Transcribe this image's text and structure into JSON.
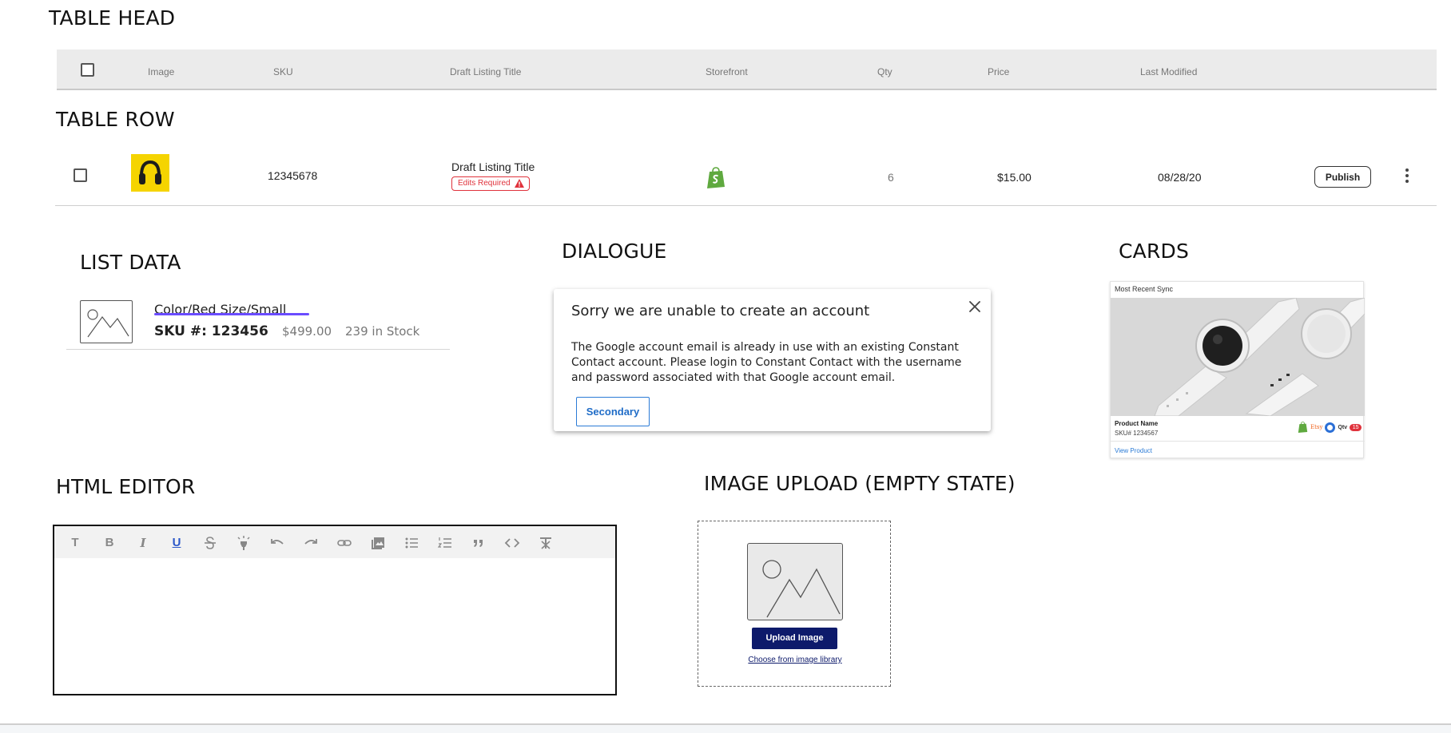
{
  "sections": {
    "table_head": "TABLE HEAD",
    "table_row": "TABLE ROW",
    "list_data": "LIST DATA",
    "dialogue": "DIALOGUE",
    "cards": "CARDS",
    "html_editor": "HTML EDITOR",
    "image_upload": "IMAGE UPLOAD (EMPTY STATE)"
  },
  "table": {
    "columns": [
      "Image",
      "SKU",
      "Draft Listing Title",
      "Storefront",
      "Qty",
      "Price",
      "Last Modified"
    ],
    "row": {
      "checked": false,
      "image_icon": "headphones-thumbnail",
      "sku": "12345678",
      "title": "Draft Listing Title",
      "badge": "Edits Required",
      "badge_icon": "warning-icon",
      "storefront_icon": "shopify-icon",
      "qty": "6",
      "price": "$15.00",
      "last_modified": "08/28/20",
      "publish_label": "Publish",
      "more_icon": "more-vertical-icon"
    }
  },
  "list_data": {
    "variant": "Color/Red   Size/Small",
    "sku": "SKU #: 123456",
    "price": "$499.00",
    "stock": "239 in Stock"
  },
  "dialog": {
    "title": "Sorry we are unable to create an account",
    "body": "The Google account email is already in use with an existing Constant Contact account.  Please login to Constant Contact with the username and password associated with that Google account email.",
    "button_label": "Secondary",
    "close_icon": "close-icon"
  },
  "card": {
    "header": "Most Recent Sync",
    "product_name": "Product Name",
    "sku": "SKU# 1234567",
    "link": "View Product",
    "channel_etsy": "Etsy",
    "channel_qtv": "Qtv",
    "count": "15"
  },
  "editor": {
    "toolbar": [
      "text-icon",
      "bold-icon",
      "italic-icon",
      "underline-icon",
      "strikethrough-icon",
      "highlight-icon",
      "undo-icon",
      "redo-icon",
      "link-icon",
      "image-icon",
      "bullet-list-icon",
      "numbered-list-icon",
      "quote-icon",
      "code-icon",
      "clear-format-icon"
    ],
    "letters": {
      "text": "T",
      "bold": "B",
      "italic": "I",
      "underline": "U"
    }
  },
  "upload": {
    "button_label": "Upload Image",
    "link": "Choose from image library"
  },
  "colors": {
    "accent_blue": "#2b7bd6",
    "navy": "#0d1a6b",
    "error_red": "#e0323c",
    "shopify_green": "#5fa93f",
    "underline_purple": "#6a4cff",
    "thumb_yellow": "#f5d400"
  }
}
